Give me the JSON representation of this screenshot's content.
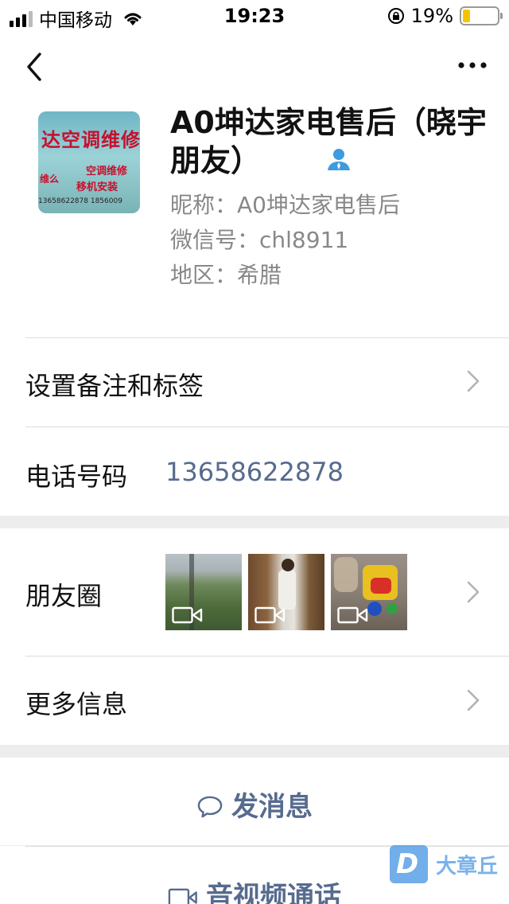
{
  "status_bar": {
    "carrier": "中国移动",
    "time": "19:23",
    "battery": "19%",
    "battery_level": 0.19
  },
  "profile": {
    "name": "A0坤达家电售后（晓宇朋友）",
    "avatar_text": {
      "line1": "达空调维修",
      "line2": "空调维修",
      "line3": "移机安装",
      "line4": "13658622878  1856009",
      "side": "维么"
    },
    "nickname_label": "昵称：",
    "nickname": "A0坤达家电售后",
    "wechat_id_label": "微信号：",
    "wechat_id": "chl8911",
    "region_label": "地区：",
    "region": "希腊"
  },
  "rows": {
    "remark_label": "设置备注和标签",
    "phone_label": "电话号码",
    "phone_value": "13658622878",
    "moments_label": "朋友圈",
    "more_info_label": "更多信息"
  },
  "actions": {
    "send_message": "发消息",
    "video_call": "音视频通话"
  },
  "watermark": {
    "badge": "D",
    "text": "大章丘"
  },
  "colors": {
    "link": "#566b8e",
    "battery": "#f5c400",
    "separator": "#ededed"
  },
  "icons": [
    "back-icon",
    "more-icon",
    "user-icon",
    "chevron-right-icon",
    "chat-bubble-icon",
    "video-camera-icon",
    "wifi-icon"
  ]
}
